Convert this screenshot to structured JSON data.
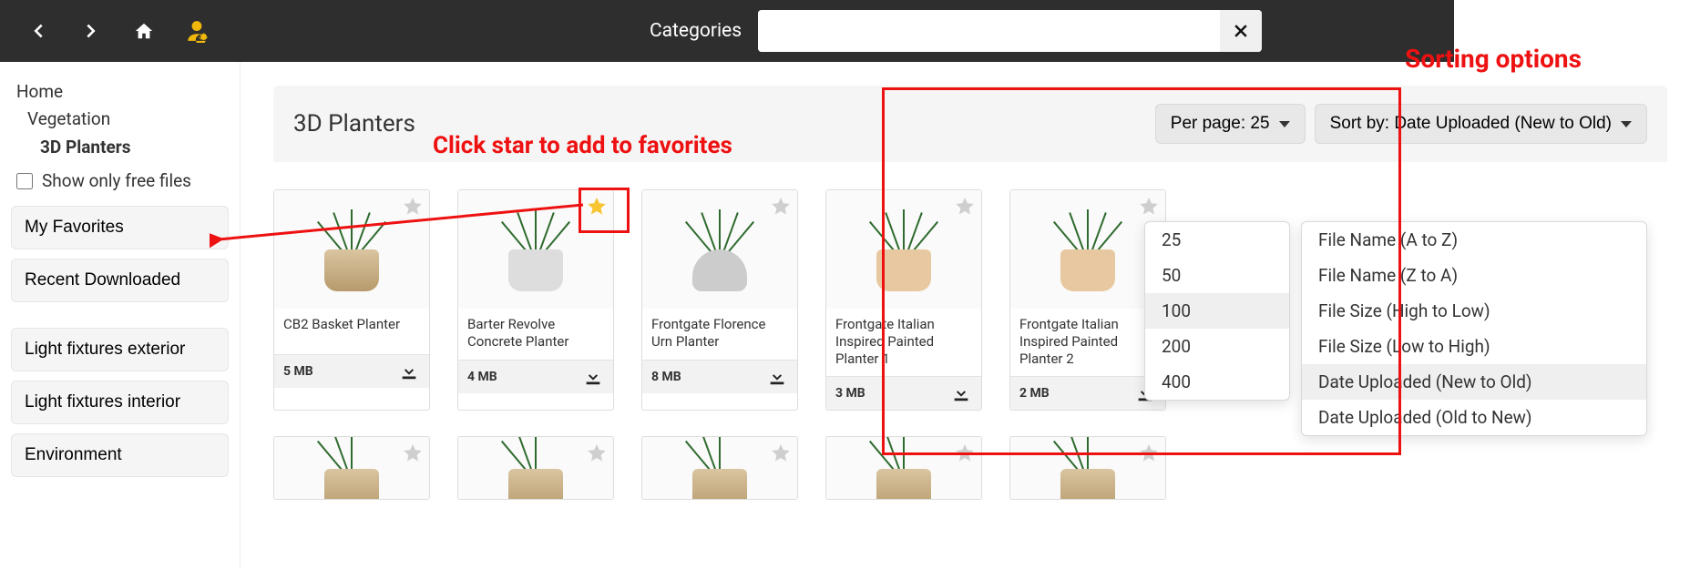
{
  "topbar": {
    "search_label": "Categories",
    "search_value": "",
    "search_placeholder": ""
  },
  "sidebar": {
    "breadcrumb": [
      "Home",
      "Vegetation",
      "3D Planters"
    ],
    "free_label": "Show only free files",
    "favorites_btn": "My Favorites",
    "recent_btn": "Recent Downloaded",
    "categories": [
      "Light fixtures exterior",
      "Light fixtures interior",
      "Environment"
    ]
  },
  "main": {
    "title": "3D Planters",
    "per_page_label": "Per page: 25",
    "sort_label": "Sort by: Date Uploaded (New to Old)"
  },
  "per_page_options": [
    "25",
    "50",
    "100",
    "200",
    "400"
  ],
  "per_page_selected": "100",
  "sort_options": [
    "File Name (A to Z)",
    "File Name (Z to A)",
    "File Size (High to Low)",
    "File Size (Low to High)",
    "Date Uploaded (New to Old)",
    "Date Uploaded (Old to New)"
  ],
  "sort_selected": "Date Uploaded (New to Old)",
  "items": [
    {
      "name": "CB2 Basket Planter",
      "size": "5 MB",
      "fav": false
    },
    {
      "name": "Barter Revolve Concrete Planter",
      "size": "4 MB",
      "fav": true
    },
    {
      "name": "Frontgate Florence Urn Planter",
      "size": "8 MB",
      "fav": false
    },
    {
      "name": "Frontgate Italian Inspired Painted Planter 1",
      "size": "3 MB",
      "fav": false
    },
    {
      "name": "Frontgate Italian Inspired Painted Planter 2",
      "size": "2 MB",
      "fav": false
    }
  ],
  "annotations": {
    "sorting": "Sorting options",
    "fav_hint": "Click star to add to favorites"
  }
}
